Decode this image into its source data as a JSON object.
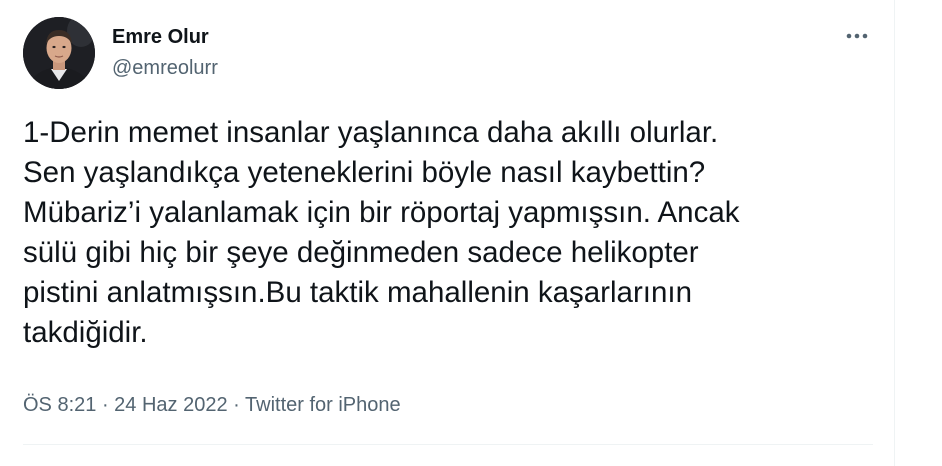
{
  "author": {
    "name": "Emre Olur",
    "handle": "@emreolurr"
  },
  "tweet": {
    "text": "1-Derin memet insanlar yaşlanınca daha akıllı olurlar.\nSen yaşlandıkça yeteneklerini böyle nasıl kaybettin?\nMübariz’i yalanlamak için bir röportaj yapmışsın. Ancak\nsülü gibi hiç bir şeye değinmeden sadece helikopter\npistini anlatmışsın.Bu taktik mahallenin kaşarlarının\ntakdiğidir."
  },
  "meta": {
    "time": "ÖS 8:21",
    "separator": " · ",
    "date": "24 Haz 2022",
    "source": "Twitter for iPhone"
  },
  "icons": {
    "more": "more-horizontal-icon"
  },
  "colors": {
    "text_primary": "#0f1419",
    "text_secondary": "#536471",
    "divider": "#eff3f4"
  }
}
